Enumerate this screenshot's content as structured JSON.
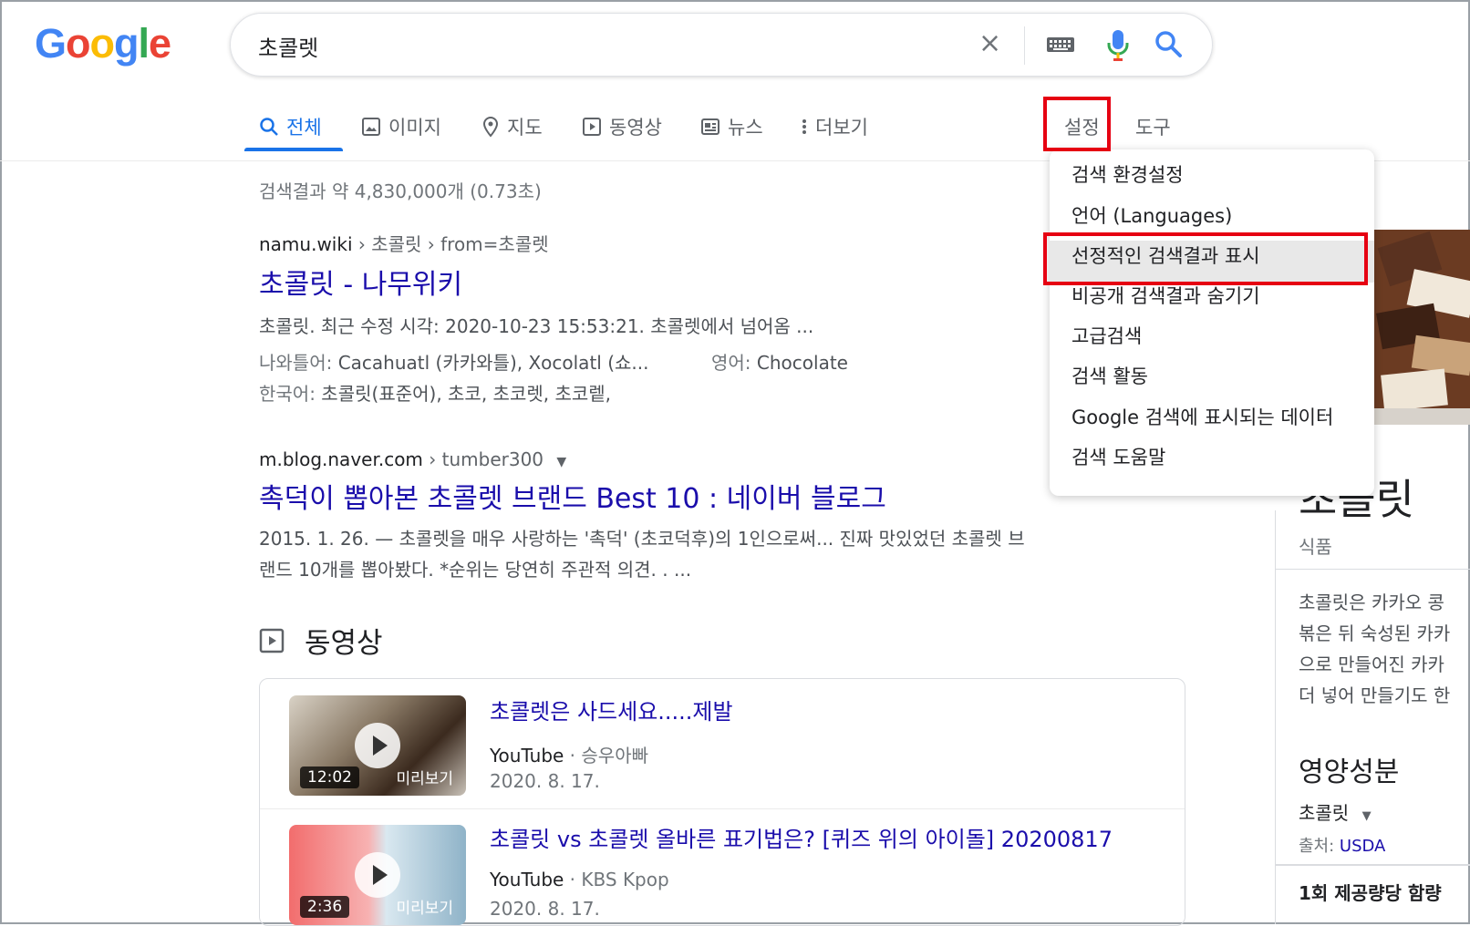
{
  "logo": {
    "letters": [
      "G",
      "o",
      "o",
      "g",
      "l",
      "e"
    ],
    "colors": [
      "#4285f4",
      "#ea4335",
      "#fbbc05",
      "#4285f4",
      "#34a853",
      "#ea4335"
    ]
  },
  "search": {
    "query": "초콜렛",
    "clear": "×"
  },
  "tabs": [
    {
      "label": "전체",
      "icon": "search-icon"
    },
    {
      "label": "이미지",
      "icon": "image-icon"
    },
    {
      "label": "지도",
      "icon": "map-pin-icon"
    },
    {
      "label": "동영상",
      "icon": "video-icon"
    },
    {
      "label": "뉴스",
      "icon": "news-icon"
    },
    {
      "label": "더보기",
      "icon": "more-vert-icon"
    },
    {
      "label": "설정"
    },
    {
      "label": "도구"
    }
  ],
  "stats": "검색결과 약 4,830,000개 (0.73초)",
  "results": [
    {
      "site": "namu.wiki",
      "crumb": " › 초콜릿 › from=초콜렛",
      "title": "초콜릿 - 나무위키",
      "snippet1": "초콜릿. 최근 수정 시각: 2020-10-23 15:53:21. 초콜렛에서 넘어옴 ...",
      "facts": [
        {
          "k": "나와틀어:",
          "v": " Cacahuatl (카카와틀), Xocolatl (쇼..."
        },
        {
          "k": "영어:",
          "v": " Chocolate"
        },
        {
          "k": "한국어:",
          "v": " 초콜릿(표준어), 초코, 초코렛, 초코렡,"
        }
      ]
    },
    {
      "site": "m.blog.naver.com",
      "crumb": " › tumber300",
      "title": "촉덕이 뽑아본 초콜렛 브랜드 Best 10 : 네이버 블로그",
      "snippet1": "2015. 1. 26. — 초콜렛을 매우 사랑하는 '촉덕' (초코덕후)의 1인으로써... 진짜 맛있었던 초콜렛 브",
      "snippet2": "랜드 10개를 뽑아봤다. *순위는 당연히 주관적 의견. .  ..."
    }
  ],
  "videos": {
    "heading": "동영상",
    "items": [
      {
        "title": "초콜렛은 사드세요.....제발",
        "source": "YouTube",
        "channel": "승우아빠",
        "date": "2020. 8. 17.",
        "duration": "12:02",
        "preview": "미리보기"
      },
      {
        "title": "초콜릿 vs 초콜렛 올바른 표기법은? [퀴즈 위의 아이돌] 20200817",
        "source": "YouTube",
        "channel": "KBS Kpop",
        "date": "2020. 8. 17.",
        "duration": "2:36",
        "preview": "미리보기"
      }
    ]
  },
  "knowledge_panel": {
    "title": "초콜릿",
    "subtitle": "식품",
    "desc": [
      "초콜릿은 카카오 콩",
      "볶은 뒤 숙성된 카카",
      "으로 만들어진 카카",
      "더 넣어 만들기도 한"
    ],
    "nutrition": "영양성분",
    "item": "초콜릿",
    "source_label": "출처: ",
    "source": "USDA",
    "serving": "1회 제공량당 함량"
  },
  "settings_menu": [
    "검색 환경설정",
    "언어 (Languages)",
    "선정적인 검색결과 표시",
    "비공개 검색결과 숨기기",
    "고급검색",
    "검색 활동",
    "Google 검색에 표시되는 데이터",
    "검색 도움말"
  ],
  "colors": {
    "link": "#1a0dab",
    "accent": "#1a73e8",
    "highlight": "#e60012"
  }
}
